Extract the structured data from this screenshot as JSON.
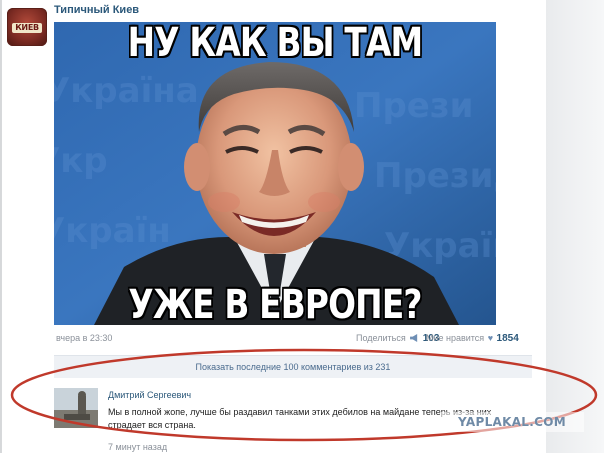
{
  "group": {
    "name": "Типичный Киев",
    "avatar_label": "КИЕВ",
    "avatar_icon": "city-logo-icon"
  },
  "post": {
    "meme_top": "НУ КАК ВЫ ТАМ",
    "meme_bottom": "УЖЕ В ЕВРОПЕ?",
    "timestamp": "вчера в 23:30",
    "share_label": "Поделиться",
    "share_count": "103",
    "like_label": "Мне нравится",
    "like_count": "1854"
  },
  "comments": {
    "show_more": "Показать последние 100 комментариев из 231",
    "items": [
      {
        "author": "Дмитрий Сергеевич",
        "text": "Мы в полной жопе, лучше бы раздавил танками этих дебилов на майдане теперь из-за них страдает вся страна.",
        "time": "7 минут назад"
      }
    ]
  },
  "watermark": "YAPLAKAL.COM",
  "colors": {
    "link": "#2b587a",
    "annotation": "#c0392b",
    "meme_bg": "#2e63a8"
  }
}
